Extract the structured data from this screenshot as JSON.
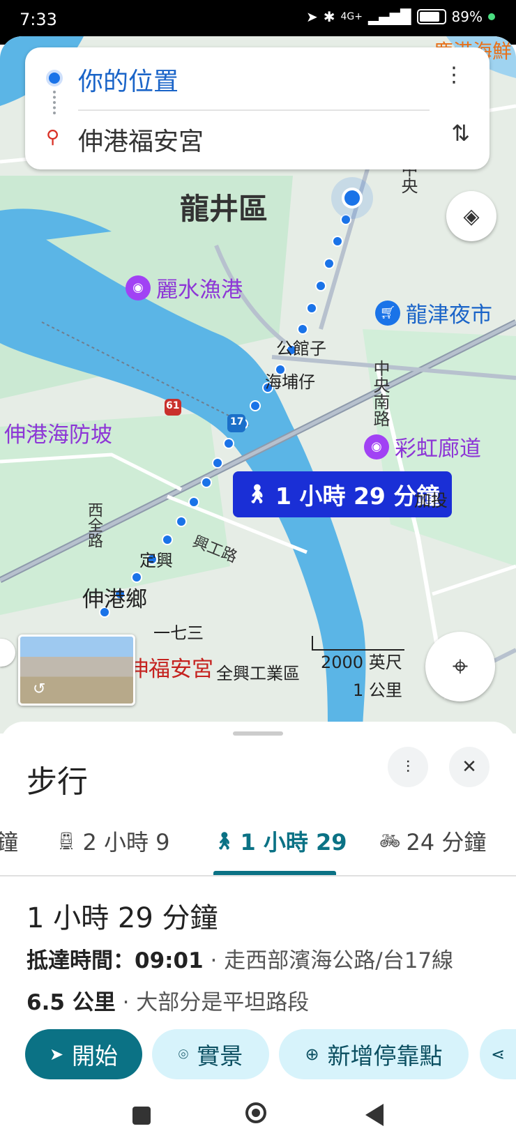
{
  "status_bar": {
    "time": "7:33",
    "network": "4G+",
    "battery": "89%"
  },
  "search_card": {
    "origin": "你的位置",
    "destination": "伸港福安宮"
  },
  "map": {
    "labels": {
      "district": "龍井區",
      "fishing_port": "麗水漁港",
      "night_market": "龍津夜市",
      "gongguanzi": "公館子",
      "haibuzai": "海埔仔",
      "zhongyang_s_rd": "中央南路",
      "zhongyang": "中央",
      "seawall": "伸港海防坡",
      "rainbow": "彩虹廊道",
      "jiatou": "加投",
      "xiquan_rd": "西全路",
      "dingxing": "定興",
      "xinggong_rd": "興工路",
      "shengang": "伸港鄉",
      "yiqisan": "一七三",
      "temple": "伸福安宮",
      "industrial": "全興工業區",
      "top_right": "鹿港海鮮",
      "route_61": "61",
      "route_17": "17"
    },
    "scale": {
      "imperial": "2000 英尺",
      "metric": "1 公里"
    },
    "route_duration_label": "1 小時 29 分鐘"
  },
  "sheet": {
    "mode_title": "步行",
    "tabs": [
      {
        "label": "鐘",
        "icon": "car-icon"
      },
      {
        "label": "2 小時 9",
        "icon": "train-icon"
      },
      {
        "label": "1 小時 29",
        "icon": "walk-icon",
        "active": true
      },
      {
        "label": "24 分鐘",
        "icon": "bike-icon"
      }
    ],
    "duration": "1 小時 29 分鐘",
    "arrival_label": "抵達時間：09:01",
    "via": "· 走西部濱海公路/台17線",
    "distance": "6.5 公里",
    "terrain": "· 大部分是平坦路段",
    "buttons": {
      "start": "開始",
      "live_view": "實景",
      "add_stop": "新增停靠點"
    }
  },
  "colors": {
    "accent_blue": "#1a73e8",
    "route_label_bg": "#1a2fd6",
    "start_button": "#0b7285",
    "chip_bg": "#d7f3fb",
    "water": "#5bb5e6",
    "land_green": "#c9ead2"
  }
}
